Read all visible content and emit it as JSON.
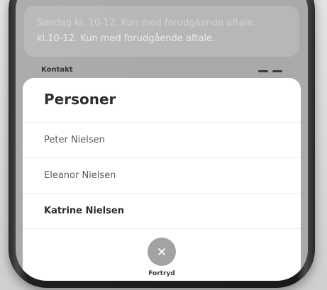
{
  "background": {
    "info_lines": [
      "Søndag kl. 10-12. Kun med forudgående aftale.",
      "kl.10-12. Kun med forudgående aftale."
    ],
    "section_label": "Kontakt"
  },
  "sheet": {
    "title": "Personer",
    "persons": [
      {
        "name": "Peter Nielsen",
        "selected": false
      },
      {
        "name": "Eleanor Nielsen",
        "selected": false
      },
      {
        "name": "Katrine Nielsen",
        "selected": true
      }
    ],
    "cancel_label": "Fortryd",
    "cancel_icon": "close-icon"
  },
  "colors": {
    "sheet_bg": "#ffffff",
    "cancel_circle": "#a3a3a3",
    "text_primary": "#2b2b2b",
    "text_secondary": "#5c5c5c"
  }
}
